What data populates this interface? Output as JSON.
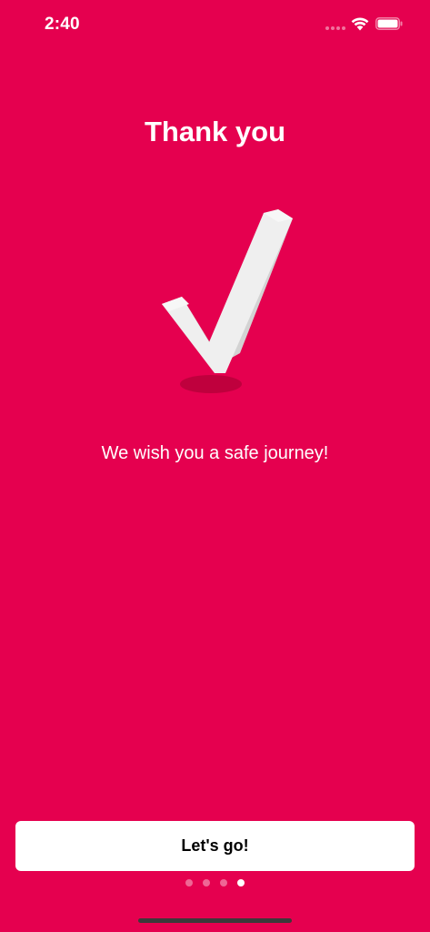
{
  "status_bar": {
    "time": "2:40"
  },
  "screen": {
    "title": "Thank you",
    "subtitle": "We wish you a safe journey!",
    "illustration": "checkmark-icon",
    "button_label": "Let's go!"
  },
  "pagination": {
    "total": 4,
    "active_index": 3
  },
  "colors": {
    "background": "#E5004F",
    "button_background": "#FFFFFF",
    "text": "#FFFFFF"
  }
}
